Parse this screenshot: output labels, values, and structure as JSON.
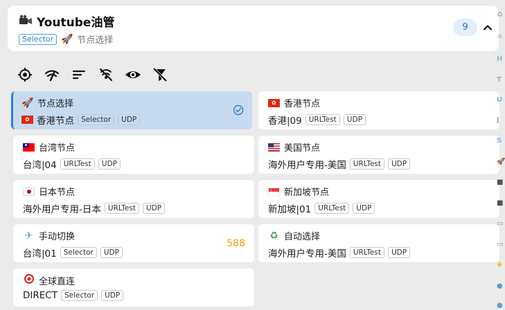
{
  "header": {
    "title": "Youtube油管",
    "type_tag": "Selector",
    "current": "节点选择",
    "count": "9"
  },
  "toolbar": {
    "buttons": [
      "locate-icon",
      "delay-test-icon",
      "sort-icon",
      "hide-unavailable-icon",
      "visibility-icon",
      "filter-off-icon"
    ]
  },
  "colors": {
    "accent": "#2c7fd0",
    "selected_bg": "#c7daf0",
    "delay": "#f2a20c"
  },
  "cards": [
    {
      "name": "节点选择",
      "icon": "rocket-icon",
      "now": "香港节点",
      "tags": [
        "Selector",
        "UDP"
      ]
    },
    {
      "name": "香港节点",
      "icon": "hk-flag-icon",
      "now": "香港|09",
      "tags": [
        "URLTest",
        "UDP"
      ]
    },
    {
      "name": "台湾节点",
      "icon": "tw-flag-icon",
      "now": "台湾|04",
      "tags": [
        "URLTest",
        "UDP"
      ]
    },
    {
      "name": "美国节点",
      "icon": "us-flag-icon",
      "now": "海外用户专用-美国",
      "tags": [
        "URLTest",
        "UDP"
      ]
    },
    {
      "name": "日本节点",
      "icon": "jp-flag-icon",
      "now": "海外用户专用-日本",
      "tags": [
        "URLTest",
        "UDP"
      ]
    },
    {
      "name": "新加坡节点",
      "icon": "sg-flag-icon",
      "now": "新加坡|01",
      "tags": [
        "URLTest",
        "UDP"
      ]
    },
    {
      "name": "手动切换",
      "icon": "airplane-icon",
      "now": "台湾|01",
      "tags": [
        "Selector",
        "UDP"
      ],
      "delay": "588"
    },
    {
      "name": "自动选择",
      "icon": "recycle-icon",
      "now": "海外用户专用-美国",
      "tags": [
        "URLTest",
        "UDP"
      ]
    },
    {
      "name": "全球直连",
      "icon": "target-icon",
      "now": "DIRECT",
      "tags": [
        "Selector",
        "UDP"
      ]
    }
  ],
  "side_strip": [
    "H",
    "T",
    "U",
    "J",
    "S"
  ]
}
